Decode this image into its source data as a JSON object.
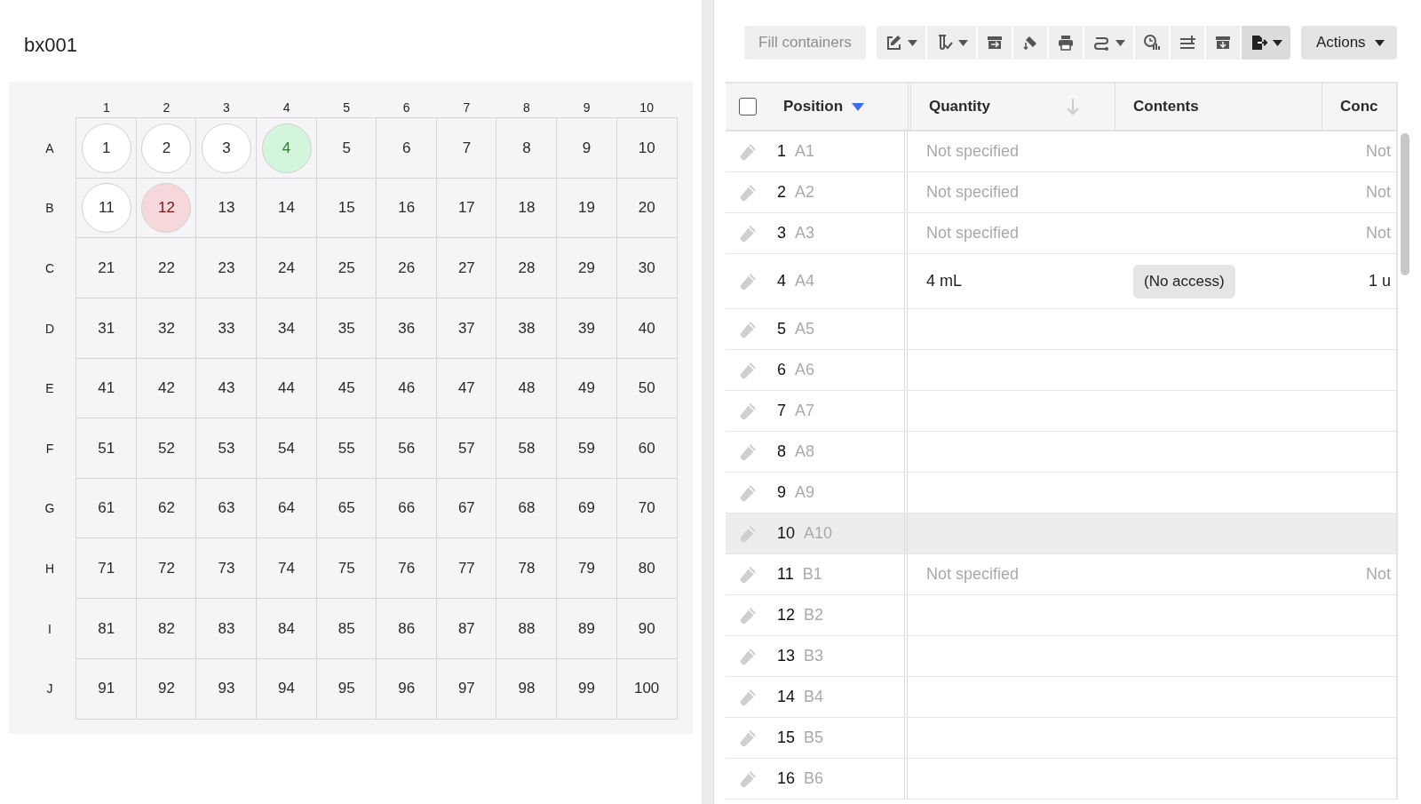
{
  "box": {
    "title": "bx001",
    "column_labels": [
      "1",
      "2",
      "3",
      "4",
      "5",
      "6",
      "7",
      "8",
      "9",
      "10"
    ],
    "rows": [
      {
        "label": "A",
        "wells": [
          {
            "label": "1",
            "kind": "tube"
          },
          {
            "label": "2",
            "kind": "tube"
          },
          {
            "label": "3",
            "kind": "tube"
          },
          {
            "label": "4",
            "kind": "tube-ok"
          },
          {
            "label": "5",
            "kind": "none"
          },
          {
            "label": "6",
            "kind": "none"
          },
          {
            "label": "7",
            "kind": "none"
          },
          {
            "label": "8",
            "kind": "none"
          },
          {
            "label": "9",
            "kind": "none"
          },
          {
            "label": "10",
            "kind": "none"
          }
        ]
      },
      {
        "label": "B",
        "wells": [
          {
            "label": "11",
            "kind": "tube"
          },
          {
            "label": "12",
            "kind": "tube-error"
          },
          {
            "label": "13",
            "kind": "none"
          },
          {
            "label": "14",
            "kind": "none"
          },
          {
            "label": "15",
            "kind": "none"
          },
          {
            "label": "16",
            "kind": "none"
          },
          {
            "label": "17",
            "kind": "none"
          },
          {
            "label": "18",
            "kind": "none"
          },
          {
            "label": "19",
            "kind": "none"
          },
          {
            "label": "20",
            "kind": "none"
          }
        ]
      },
      {
        "label": "C",
        "wells": [
          {
            "label": "21",
            "kind": "none"
          },
          {
            "label": "22",
            "kind": "none"
          },
          {
            "label": "23",
            "kind": "none"
          },
          {
            "label": "24",
            "kind": "none"
          },
          {
            "label": "25",
            "kind": "none"
          },
          {
            "label": "26",
            "kind": "none"
          },
          {
            "label": "27",
            "kind": "none"
          },
          {
            "label": "28",
            "kind": "none"
          },
          {
            "label": "29",
            "kind": "none"
          },
          {
            "label": "30",
            "kind": "none"
          }
        ]
      },
      {
        "label": "D",
        "wells": [
          {
            "label": "31",
            "kind": "none"
          },
          {
            "label": "32",
            "kind": "none"
          },
          {
            "label": "33",
            "kind": "none"
          },
          {
            "label": "34",
            "kind": "none"
          },
          {
            "label": "35",
            "kind": "none"
          },
          {
            "label": "36",
            "kind": "none"
          },
          {
            "label": "37",
            "kind": "none"
          },
          {
            "label": "38",
            "kind": "none"
          },
          {
            "label": "39",
            "kind": "none"
          },
          {
            "label": "40",
            "kind": "none"
          }
        ]
      },
      {
        "label": "E",
        "wells": [
          {
            "label": "41",
            "kind": "none"
          },
          {
            "label": "42",
            "kind": "none"
          },
          {
            "label": "43",
            "kind": "none"
          },
          {
            "label": "44",
            "kind": "none"
          },
          {
            "label": "45",
            "kind": "none"
          },
          {
            "label": "46",
            "kind": "none"
          },
          {
            "label": "47",
            "kind": "none"
          },
          {
            "label": "48",
            "kind": "none"
          },
          {
            "label": "49",
            "kind": "none"
          },
          {
            "label": "50",
            "kind": "none"
          }
        ]
      },
      {
        "label": "F",
        "wells": [
          {
            "label": "51",
            "kind": "none"
          },
          {
            "label": "52",
            "kind": "none"
          },
          {
            "label": "53",
            "kind": "none"
          },
          {
            "label": "54",
            "kind": "none"
          },
          {
            "label": "55",
            "kind": "none"
          },
          {
            "label": "56",
            "kind": "none"
          },
          {
            "label": "57",
            "kind": "none"
          },
          {
            "label": "58",
            "kind": "none"
          },
          {
            "label": "59",
            "kind": "none"
          },
          {
            "label": "60",
            "kind": "none"
          }
        ]
      },
      {
        "label": "G",
        "wells": [
          {
            "label": "61",
            "kind": "none"
          },
          {
            "label": "62",
            "kind": "none"
          },
          {
            "label": "63",
            "kind": "none"
          },
          {
            "label": "64",
            "kind": "none"
          },
          {
            "label": "65",
            "kind": "none"
          },
          {
            "label": "66",
            "kind": "none"
          },
          {
            "label": "67",
            "kind": "none"
          },
          {
            "label": "68",
            "kind": "none"
          },
          {
            "label": "69",
            "kind": "none"
          },
          {
            "label": "70",
            "kind": "none"
          }
        ]
      },
      {
        "label": "H",
        "wells": [
          {
            "label": "71",
            "kind": "none"
          },
          {
            "label": "72",
            "kind": "none"
          },
          {
            "label": "73",
            "kind": "none"
          },
          {
            "label": "74",
            "kind": "none"
          },
          {
            "label": "75",
            "kind": "none"
          },
          {
            "label": "76",
            "kind": "none"
          },
          {
            "label": "77",
            "kind": "none"
          },
          {
            "label": "78",
            "kind": "none"
          },
          {
            "label": "79",
            "kind": "none"
          },
          {
            "label": "80",
            "kind": "none"
          }
        ]
      },
      {
        "label": "I",
        "wells": [
          {
            "label": "81",
            "kind": "none"
          },
          {
            "label": "82",
            "kind": "none"
          },
          {
            "label": "83",
            "kind": "none"
          },
          {
            "label": "84",
            "kind": "none"
          },
          {
            "label": "85",
            "kind": "none"
          },
          {
            "label": "86",
            "kind": "none"
          },
          {
            "label": "87",
            "kind": "none"
          },
          {
            "label": "88",
            "kind": "none"
          },
          {
            "label": "89",
            "kind": "none"
          },
          {
            "label": "90",
            "kind": "none"
          }
        ]
      },
      {
        "label": "J",
        "wells": [
          {
            "label": "91",
            "kind": "none"
          },
          {
            "label": "92",
            "kind": "none"
          },
          {
            "label": "93",
            "kind": "none"
          },
          {
            "label": "94",
            "kind": "none"
          },
          {
            "label": "95",
            "kind": "none"
          },
          {
            "label": "96",
            "kind": "none"
          },
          {
            "label": "97",
            "kind": "none"
          },
          {
            "label": "98",
            "kind": "none"
          },
          {
            "label": "99",
            "kind": "none"
          },
          {
            "label": "100",
            "kind": "none"
          }
        ]
      }
    ]
  },
  "toolbar": {
    "fill_button": {
      "label": "Fill containers",
      "disabled": true
    },
    "tools": [
      {
        "kind": "edit",
        "dropdown": true,
        "active": false
      },
      {
        "kind": "tube-check",
        "dropdown": true,
        "active": false
      },
      {
        "kind": "tray-in",
        "dropdown": false,
        "active": false
      },
      {
        "kind": "pour",
        "dropdown": false,
        "active": false
      },
      {
        "kind": "print",
        "dropdown": false,
        "active": false
      },
      {
        "kind": "route",
        "dropdown": true,
        "active": false
      },
      {
        "kind": "clock-chart",
        "dropdown": false,
        "active": false
      },
      {
        "kind": "list-plus",
        "dropdown": false,
        "active": false
      },
      {
        "kind": "tray-down",
        "dropdown": false,
        "active": false
      },
      {
        "kind": "export",
        "dropdown": true,
        "active": true
      }
    ],
    "actions_button": {
      "label": "Actions"
    }
  },
  "table": {
    "select_all": {
      "checked": false
    },
    "columns": [
      {
        "label": "Position",
        "sorted": true,
        "sort_hint": false
      },
      {
        "label": "Quantity",
        "sorted": false,
        "sort_hint": true
      },
      {
        "label": "Contents",
        "sorted": false,
        "sort_hint": false
      },
      {
        "label": "Conc",
        "sorted": false,
        "sort_hint": false
      }
    ],
    "rows": [
      {
        "number": "1",
        "position": "A1",
        "quantity": {
          "text": "Not specified",
          "muted": true
        },
        "concentration": {
          "text": "Not",
          "muted": true
        },
        "highlighted": false
      },
      {
        "number": "2",
        "position": "A2",
        "quantity": {
          "text": "Not specified",
          "muted": true
        },
        "concentration": {
          "text": "Not",
          "muted": true
        },
        "highlighted": false
      },
      {
        "number": "3",
        "position": "A3",
        "quantity": {
          "text": "Not specified",
          "muted": true
        },
        "concentration": {
          "text": "Not",
          "muted": true
        },
        "highlighted": false
      },
      {
        "number": "4",
        "position": "A4",
        "quantity": {
          "text": "4 mL",
          "muted": false
        },
        "contents": "(No access)",
        "concentration": {
          "text": "1 u",
          "muted": false
        },
        "highlighted": false
      },
      {
        "number": "5",
        "position": "A5",
        "highlighted": false
      },
      {
        "number": "6",
        "position": "A6",
        "highlighted": false
      },
      {
        "number": "7",
        "position": "A7",
        "highlighted": false
      },
      {
        "number": "8",
        "position": "A8",
        "highlighted": false
      },
      {
        "number": "9",
        "position": "A9",
        "highlighted": false
      },
      {
        "number": "10",
        "position": "A10",
        "highlighted": true
      },
      {
        "number": "11",
        "position": "B1",
        "quantity": {
          "text": "Not specified",
          "muted": true
        },
        "concentration": {
          "text": "Not",
          "muted": true
        },
        "highlighted": false
      },
      {
        "number": "12",
        "position": "B2",
        "highlighted": false
      },
      {
        "number": "13",
        "position": "B3",
        "highlighted": false
      },
      {
        "number": "14",
        "position": "B4",
        "highlighted": false
      },
      {
        "number": "15",
        "position": "B5",
        "highlighted": false
      },
      {
        "number": "16",
        "position": "B6",
        "highlighted": false
      }
    ]
  }
}
